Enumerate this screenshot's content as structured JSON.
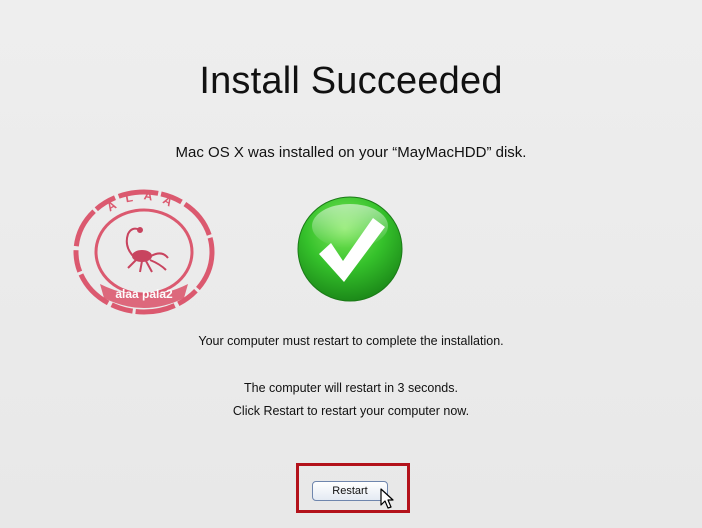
{
  "installer": {
    "title": "Install Succeeded",
    "subtitle": "Mac OS X was installed on your “MayMacHDD” disk.",
    "restart_notice": "Your computer must restart to complete the installation.",
    "countdown_text": "The computer will restart in 3 seconds.",
    "restart_hint": "Click Restart to restart your computer now.",
    "restart_button_label": "Restart"
  },
  "watermark": {
    "stamp_text_top": "A L A A",
    "stamp_text_bottom": "alaa pala2",
    "color": "#d9405a"
  },
  "colors": {
    "success": "#2cb82a",
    "highlight_border": "#b3121b",
    "background": "#ececec"
  },
  "icons": {
    "success": "checkmark-icon",
    "pointer": "mouse-pointer-icon"
  }
}
